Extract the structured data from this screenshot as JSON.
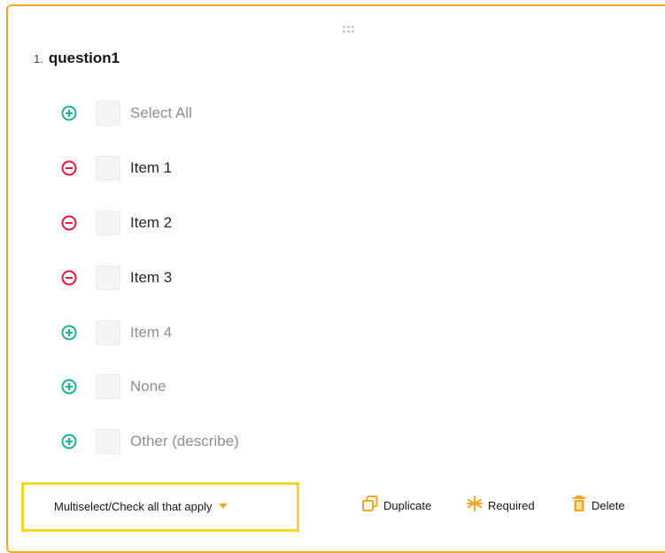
{
  "question": {
    "number": "1.",
    "name": "question1"
  },
  "choices": [
    {
      "label": "Select All",
      "state": "add"
    },
    {
      "label": "Item 1",
      "state": "remove"
    },
    {
      "label": "Item 2",
      "state": "remove"
    },
    {
      "label": "Item 3",
      "state": "remove"
    },
    {
      "label": "Item 4",
      "state": "add"
    },
    {
      "label": "None",
      "state": "add"
    },
    {
      "label": "Other (describe)",
      "state": "add"
    }
  ],
  "footer": {
    "question_type": "Multiselect/Check all that apply",
    "duplicate_label": "Duplicate",
    "required_label": "Required",
    "delete_label": "Delete"
  },
  "colors": {
    "accent": "#f5a623",
    "highlight": "#f5d623",
    "add_icon": "#19b394",
    "remove_icon": "#e5173f"
  }
}
